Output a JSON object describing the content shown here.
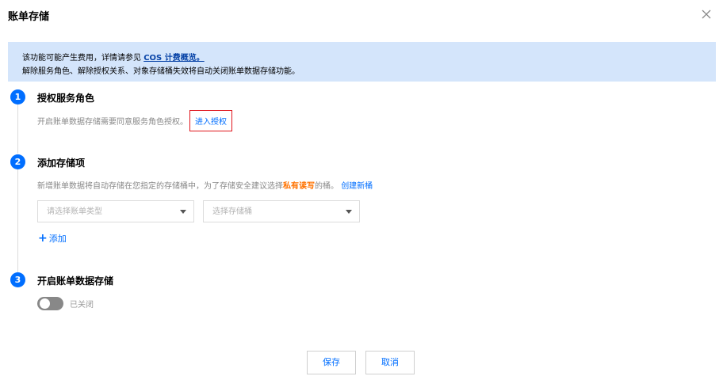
{
  "dialog": {
    "title": "账单存储"
  },
  "notice": {
    "line1_prefix": "该功能可能产生费用，详情请参见 ",
    "line1_link": "COS 计费概览。",
    "line2": "解除服务角色、解除授权关系、对象存储桶失效将自动关闭账单数据存储功能。"
  },
  "steps": [
    {
      "num": "1",
      "title": "授权服务角色",
      "desc": "开启账单数据存储需要同意服务角色授权。",
      "link": "进入授权"
    },
    {
      "num": "2",
      "title": "添加存储项",
      "desc_prefix": "新增账单数据将自动存储在您指定的存储桶中，为了存储安全建议选择",
      "desc_highlight": "私有读写",
      "desc_suffix": "的桶。",
      "link": "创建新桶",
      "select_bill_type_placeholder": "请选择账单类型",
      "select_bucket_placeholder": "选择存储桶",
      "add_label": "添加"
    },
    {
      "num": "3",
      "title": "开启账单数据存储",
      "toggle_state": "已关闭"
    }
  ],
  "footer": {
    "save_label": "保存",
    "cancel_label": "取消"
  },
  "colors": {
    "primary": "#006eff",
    "notice_bg": "#d4e5fb",
    "highlight": "#ff7200",
    "focus_border": "#e0151c"
  }
}
